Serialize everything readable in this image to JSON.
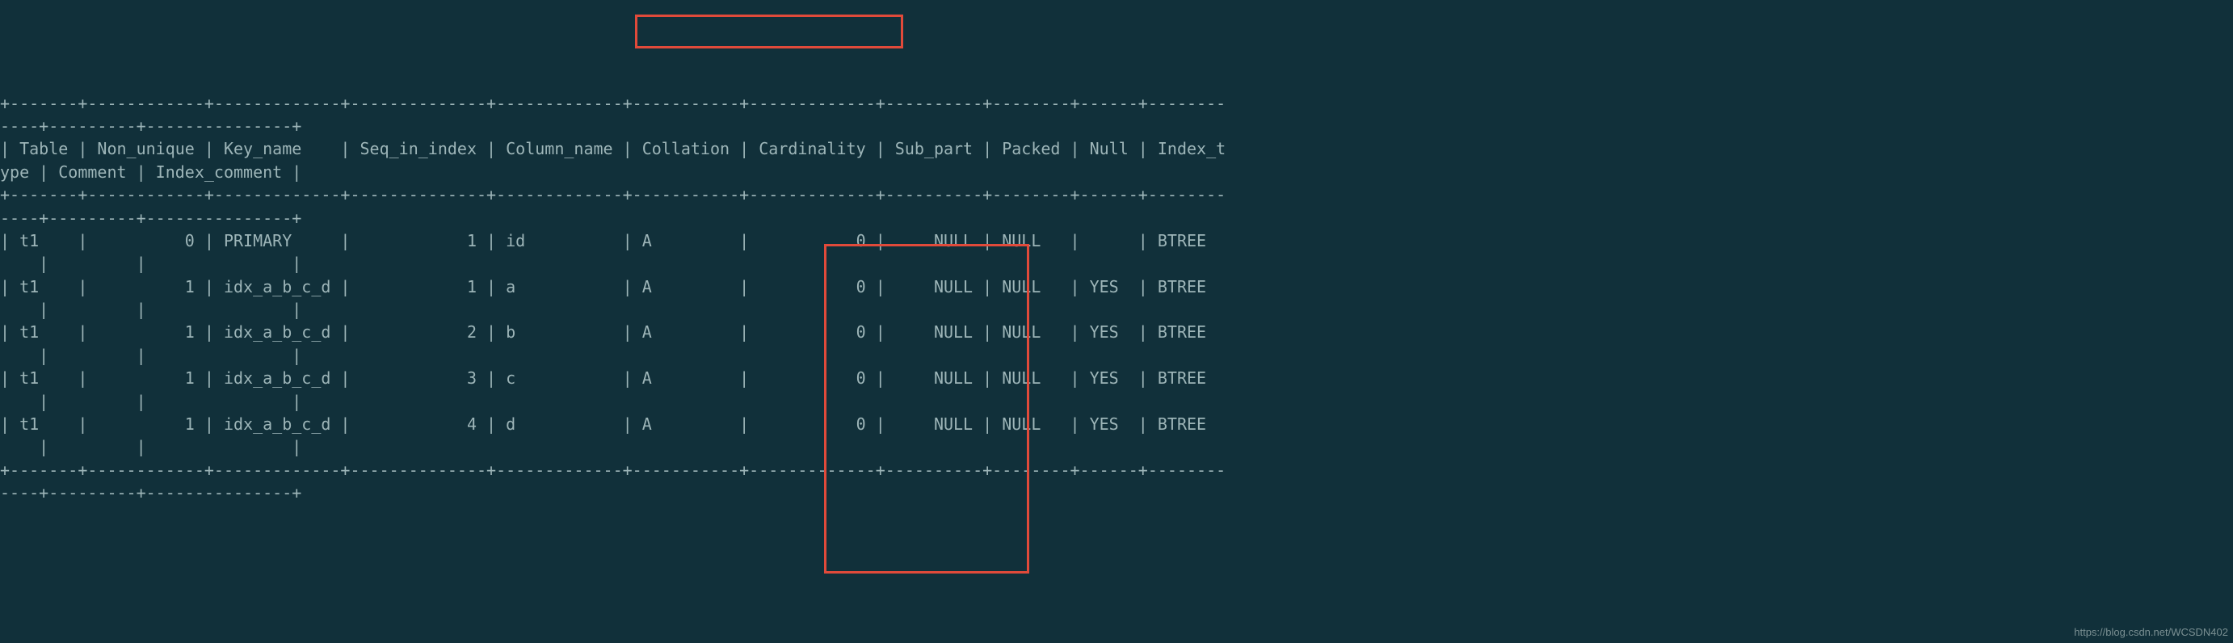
{
  "border_top": "+-------+------------+-------------+--------------+-------------+-----------+-------------+----------+--------+------+------------+---------+---------------+",
  "header_line1": "| Table | Non_unique | Key_name    | Seq_in_index | Column_name | Collation | Cardinality | Sub_part | Packed | Null | Index_type | Comment | Index_comment |",
  "header_wrap_1": "| Table | Non_unique | Key_name    | Seq_in_index | Column_name | Collation | Cardinality | Sub_part | Packed | Null | Index_t",
  "header_wrap_2": "ype | Comment | Index_comment |",
  "columns": [
    "Table",
    "Non_unique",
    "Key_name",
    "Seq_in_index",
    "Column_name",
    "Collation",
    "Cardinality",
    "Sub_part",
    "Packed",
    "Null",
    "Index_type",
    "Comment",
    "Index_comment"
  ],
  "rows": [
    {
      "Table": "t1",
      "Non_unique": "0",
      "Key_name": "PRIMARY",
      "Seq_in_index": "1",
      "Column_name": "id",
      "Collation": "A",
      "Cardinality": "0",
      "Sub_part": "NULL",
      "Packed": "NULL",
      "Null": "",
      "Index_type": "BTREE",
      "Comment": "",
      "Index_comment": ""
    },
    {
      "Table": "t1",
      "Non_unique": "1",
      "Key_name": "idx_a_b_c_d",
      "Seq_in_index": "1",
      "Column_name": "a",
      "Collation": "A",
      "Cardinality": "0",
      "Sub_part": "NULL",
      "Packed": "NULL",
      "Null": "YES",
      "Index_type": "BTREE",
      "Comment": "",
      "Index_comment": ""
    },
    {
      "Table": "t1",
      "Non_unique": "1",
      "Key_name": "idx_a_b_c_d",
      "Seq_in_index": "2",
      "Column_name": "b",
      "Collation": "A",
      "Cardinality": "0",
      "Sub_part": "NULL",
      "Packed": "NULL",
      "Null": "YES",
      "Index_type": "BTREE",
      "Comment": "",
      "Index_comment": ""
    },
    {
      "Table": "t1",
      "Non_unique": "1",
      "Key_name": "idx_a_b_c_d",
      "Seq_in_index": "3",
      "Column_name": "c",
      "Collation": "A",
      "Cardinality": "0",
      "Sub_part": "NULL",
      "Packed": "NULL",
      "Null": "YES",
      "Index_type": "BTREE",
      "Comment": "",
      "Index_comment": ""
    },
    {
      "Table": "t1",
      "Non_unique": "1",
      "Key_name": "idx_a_b_c_d",
      "Seq_in_index": "4",
      "Column_name": "d",
      "Collation": "A",
      "Cardinality": "0",
      "Sub_part": "NULL",
      "Packed": "NULL",
      "Null": "YES",
      "Index_type": "BTREE",
      "Comment": "",
      "Index_comment": ""
    }
  ],
  "watermark": "https://blog.csdn.net/WCSDN402"
}
